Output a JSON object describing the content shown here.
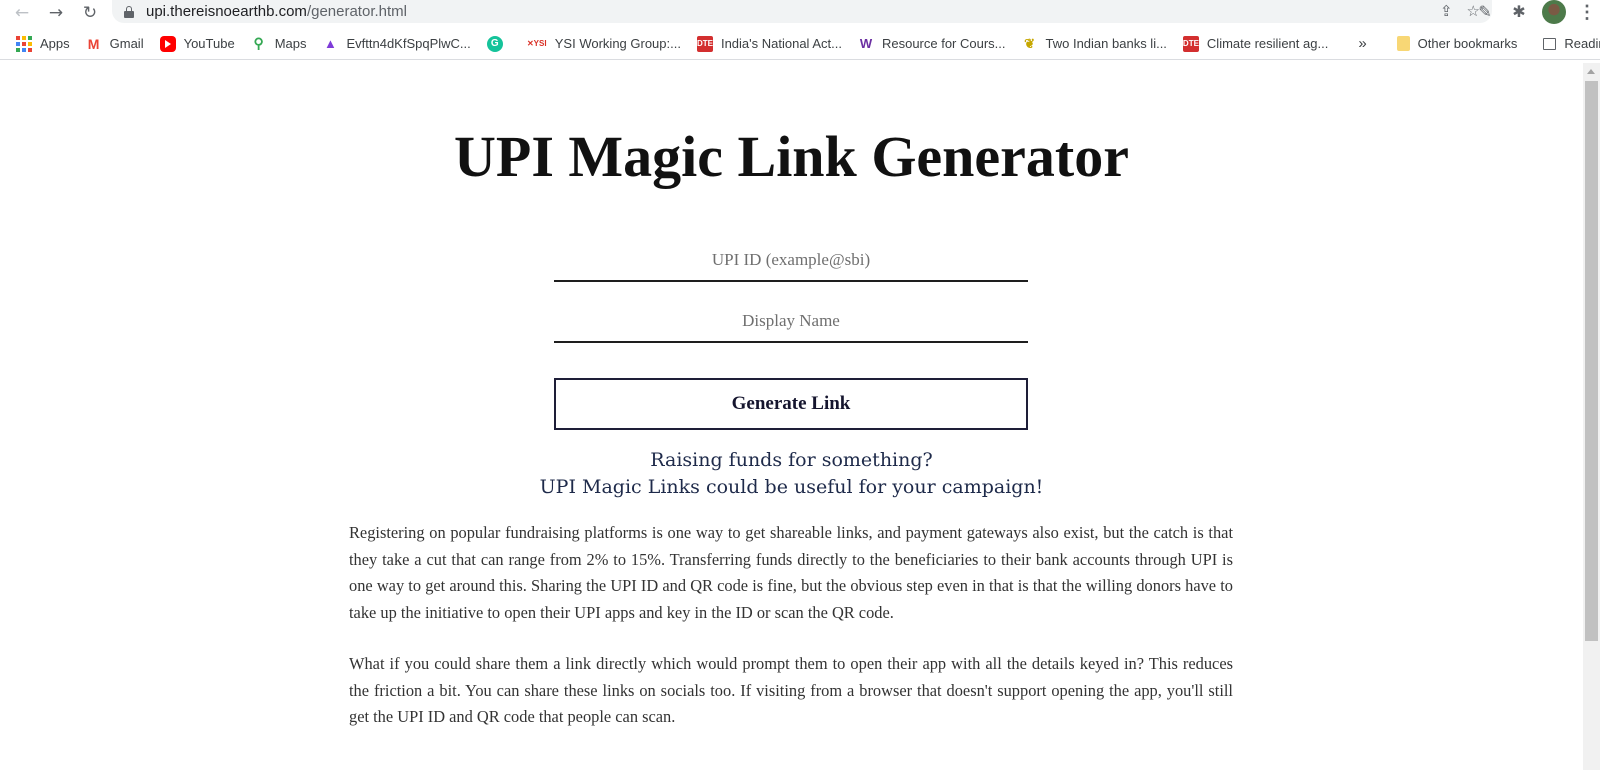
{
  "browser": {
    "url_host": "upi.thereisnoearthb.com",
    "url_path": "/generator.html",
    "bookmarks": [
      {
        "label": "Apps",
        "icon": "apps-grid-icon"
      },
      {
        "label": "Gmail",
        "icon": "gmail-icon"
      },
      {
        "label": "YouTube",
        "icon": "youtube-icon"
      },
      {
        "label": "Maps",
        "icon": "maps-icon"
      },
      {
        "label": "Evfttn4dKfSpqPlwC...",
        "icon": "graduation-cap-icon"
      },
      {
        "label": "",
        "icon": "grammarly-icon"
      },
      {
        "label": "YSI Working Group:...",
        "icon": "ysi-icon"
      },
      {
        "label": "India's National Act...",
        "icon": "dte-icon"
      },
      {
        "label": "Resource for Cours...",
        "icon": "w-logo-icon"
      },
      {
        "label": "Two Indian banks li...",
        "icon": "leaf-icon"
      },
      {
        "label": "Climate resilient ag...",
        "icon": "dte-icon"
      }
    ],
    "other_bookmarks": "Other bookmarks",
    "reading_list": "Reading list"
  },
  "page": {
    "title": "UPI Magic Link Generator",
    "upi_placeholder": "UPI ID (example@sbi)",
    "name_placeholder": "Display Name",
    "generate_label": "Generate Link",
    "tagline_1": "Raising funds for something?",
    "tagline_2": "UPI Magic Links could be useful for your campaign!",
    "para_1": "Registering on popular fundraising platforms is one way to get shareable links, and payment gateways also exist, but the catch is that they take a cut that can range from 2% to 15%. Transferring funds directly to the beneficiaries to their bank accounts through UPI is one way to get around this. Sharing the UPI ID and QR code is fine, but the obvious step even in that is that the willing donors have to take up the initiative to open their UPI apps and key in the ID or scan the QR code.",
    "para_2": "What if you could share them a link directly which would prompt them to open their app with all the details keyed in? This reduces the friction a bit. You can share these links on socials too. If visiting from a browser that doesn't support opening the app, you'll still get the UPI ID and QR code that people can scan."
  }
}
